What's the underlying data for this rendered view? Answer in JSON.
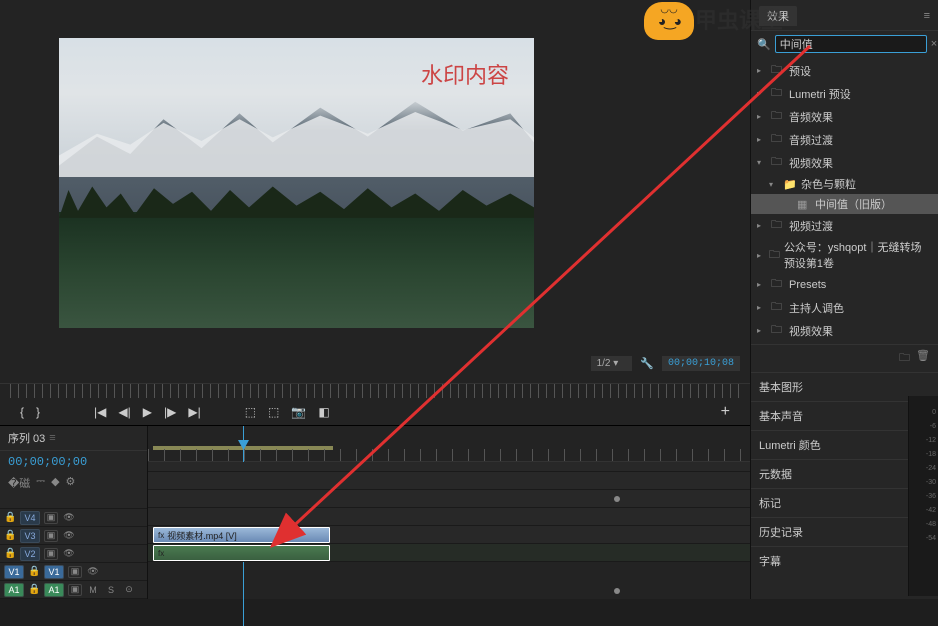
{
  "watermark": "水印内容",
  "logo_text": "甲虫课堂",
  "monitor": {
    "zoom": "1/2",
    "timecode": "00;00;10;08"
  },
  "sequence": {
    "tab": "序列 03",
    "timecode": "00;00;00;00"
  },
  "tracks": {
    "v4": "V4",
    "v3": "V3",
    "v2": "V2",
    "v1": "V1",
    "a1": "A1"
  },
  "clip": {
    "video_name": "视频素材.mp4 [V]"
  },
  "effects": {
    "panel_title": "效果",
    "search_value": "中间值",
    "items": [
      {
        "label": "预设",
        "icon": "bin",
        "arrow": ">",
        "indent": 0
      },
      {
        "label": "Lumetri 预设",
        "icon": "bin",
        "arrow": ">",
        "indent": 0
      },
      {
        "label": "音频效果",
        "icon": "bin",
        "arrow": ">",
        "indent": 0
      },
      {
        "label": "音频过渡",
        "icon": "bin",
        "arrow": ">",
        "indent": 0
      },
      {
        "label": "视频效果",
        "icon": "bin",
        "arrow": "v",
        "indent": 0
      },
      {
        "label": "杂色与颗粒",
        "icon": "folder",
        "arrow": "v",
        "indent": 1
      },
      {
        "label": "中间值（旧版）",
        "icon": "fx",
        "arrow": "",
        "indent": 2,
        "selected": true
      },
      {
        "label": "视频过渡",
        "icon": "bin",
        "arrow": ">",
        "indent": 0
      },
      {
        "label": "公众号：yshqopt｜无缝转场预设第1卷",
        "icon": "bin",
        "arrow": ">",
        "indent": 0
      },
      {
        "label": "Presets",
        "icon": "bin",
        "arrow": ">",
        "indent": 0
      },
      {
        "label": "主持人调色",
        "icon": "bin",
        "arrow": ">",
        "indent": 0
      },
      {
        "label": "视频效果",
        "icon": "bin",
        "arrow": ">",
        "indent": 0
      }
    ],
    "panels": [
      "基本图形",
      "基本声音",
      "Lumetri 颜色",
      "元数据",
      "标记",
      "历史记录",
      "字幕"
    ]
  },
  "meter_scale": [
    "0",
    "-6",
    "-12",
    "-18",
    "-24",
    "-30",
    "-36",
    "-42",
    "-48",
    "-54"
  ]
}
